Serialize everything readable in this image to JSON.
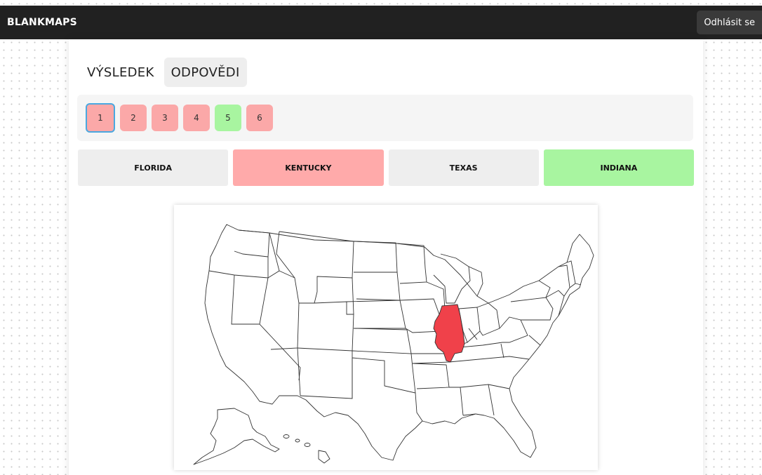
{
  "app": {
    "brand": "BLANKMAPS",
    "logout_label": "Odhlásit se"
  },
  "tabs": [
    {
      "label": "VÝSLEDEK",
      "active": false
    },
    {
      "label": "ODPOVĚDI",
      "active": true
    }
  ],
  "questions": [
    {
      "label": "1",
      "status": "wrong",
      "current": true
    },
    {
      "label": "2",
      "status": "wrong",
      "current": false
    },
    {
      "label": "3",
      "status": "wrong",
      "current": false
    },
    {
      "label": "4",
      "status": "wrong",
      "current": false
    },
    {
      "label": "5",
      "status": "right",
      "current": false
    },
    {
      "label": "6",
      "status": "wrong",
      "current": false
    }
  ],
  "answers": [
    {
      "label": "FLORIDA",
      "status": "neutral"
    },
    {
      "label": "KENTUCKY",
      "status": "wrong"
    },
    {
      "label": "TEXAS",
      "status": "neutral"
    },
    {
      "label": "INDIANA",
      "status": "right"
    }
  ],
  "map": {
    "highlight_color": "#f0414a",
    "highlighted_state": "illinois"
  },
  "colors": {
    "wrong": "#fba8a8",
    "right": "#a8f5a0",
    "topbar": "#212121",
    "current_outline": "#4aa8e0"
  }
}
